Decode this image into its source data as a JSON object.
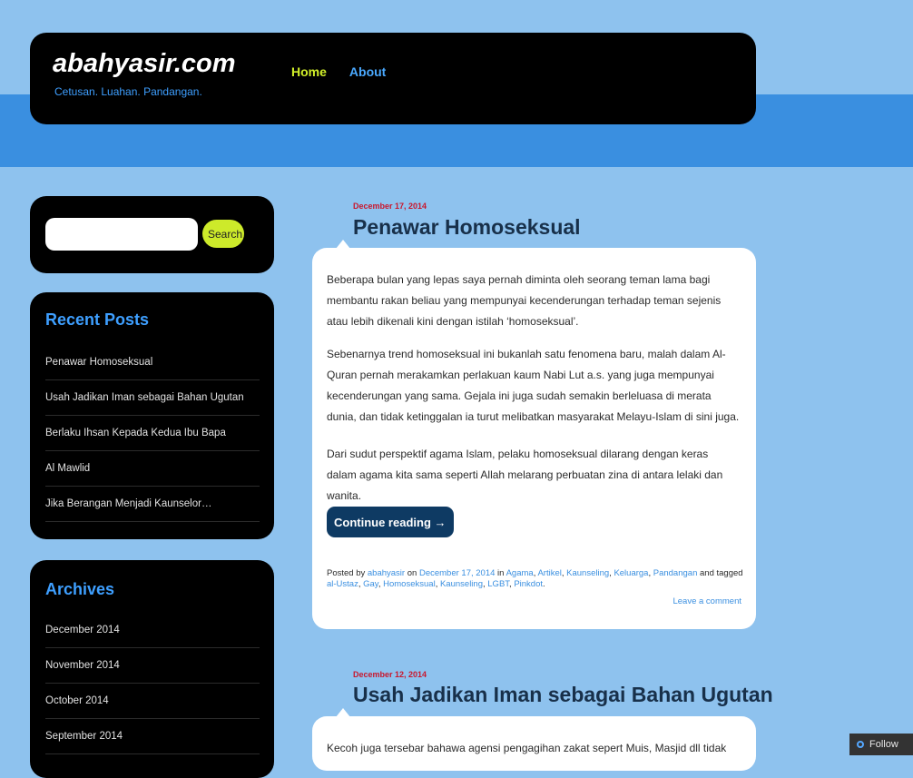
{
  "site": {
    "title": "abahyasir.com",
    "tagline": "Cetusan. Luahan. Pandangan."
  },
  "nav": [
    {
      "label": "Home",
      "active": true
    },
    {
      "label": "About",
      "active": false
    }
  ],
  "search": {
    "value": "",
    "button_label": "Search"
  },
  "recent_posts": {
    "title": "Recent Posts",
    "items": [
      "Penawar Homoseksual",
      "Usah Jadikan Iman sebagai Bahan Ugutan",
      "Berlaku Ihsan Kepada Kedua Ibu Bapa",
      "Al Mawlid",
      "Jika Berangan Menjadi Kaunselor…"
    ]
  },
  "archives": {
    "title": "Archives",
    "items": [
      "December 2014",
      "November 2014",
      "October 2014",
      "September 2014"
    ]
  },
  "posts": [
    {
      "date": "December 17, 2014",
      "title": "Penawar Homoseksual",
      "paragraphs": [
        "Beberapa bulan yang lepas saya pernah diminta oleh seorang teman lama bagi membantu rakan beliau yang mempunyai kecenderungan terhadap teman sejenis atau lebih dikenali kini dengan istilah ‘homoseksual’.",
        "Sebenarnya trend homoseksual ini bukanlah satu fenomena baru, malah dalam Al-Quran pernah merakamkan perlakuan kaum Nabi Lut a.s. yang juga mempunyai kecenderungan yang sama. Gejala ini juga sudah semakin berleluasa di merata dunia, dan tidak ketinggalan ia turut melibatkan masyarakat Melayu-Islam di sini juga.",
        "Dari sudut perspektif agama Islam, pelaku  homoseksual dilarang dengan keras dalam agama kita sama seperti Allah melarang perbuatan zina di antara lelaki dan wanita."
      ],
      "continue_label": "Continue reading →",
      "meta": {
        "posted_by": "Posted by",
        "author": "abahyasir",
        "on": "on",
        "date_link": "December 17, 2014",
        "in": "in",
        "categories": [
          "Agama",
          "Artikel",
          "Kaunseling",
          "Keluarga",
          "Pandangan"
        ],
        "and_tagged": "and tagged",
        "tags": [
          "al-Ustaz",
          "Gay",
          "Homoseksual",
          "Kaunseling",
          "LGBT",
          "Pinkdot"
        ],
        "end": ".",
        "leave_comment": "Leave a comment"
      }
    },
    {
      "date": "December 12, 2014",
      "title": "Usah Jadikan Iman sebagai Bahan Ugutan",
      "paragraphs": [
        "Kecoh juga tersebar bahawa agensi pengagihan zakat sepert Muis, Masjid dll tidak"
      ]
    }
  ],
  "follow": {
    "label": "Follow"
  },
  "colors": {
    "background": "#8ec2ee",
    "band": "#3a8fe0",
    "accent_yellow": "#d2f02a",
    "accent_blue": "#3e9fff",
    "date_red": "#c9172d",
    "button_navy": "#0e3a63"
  }
}
